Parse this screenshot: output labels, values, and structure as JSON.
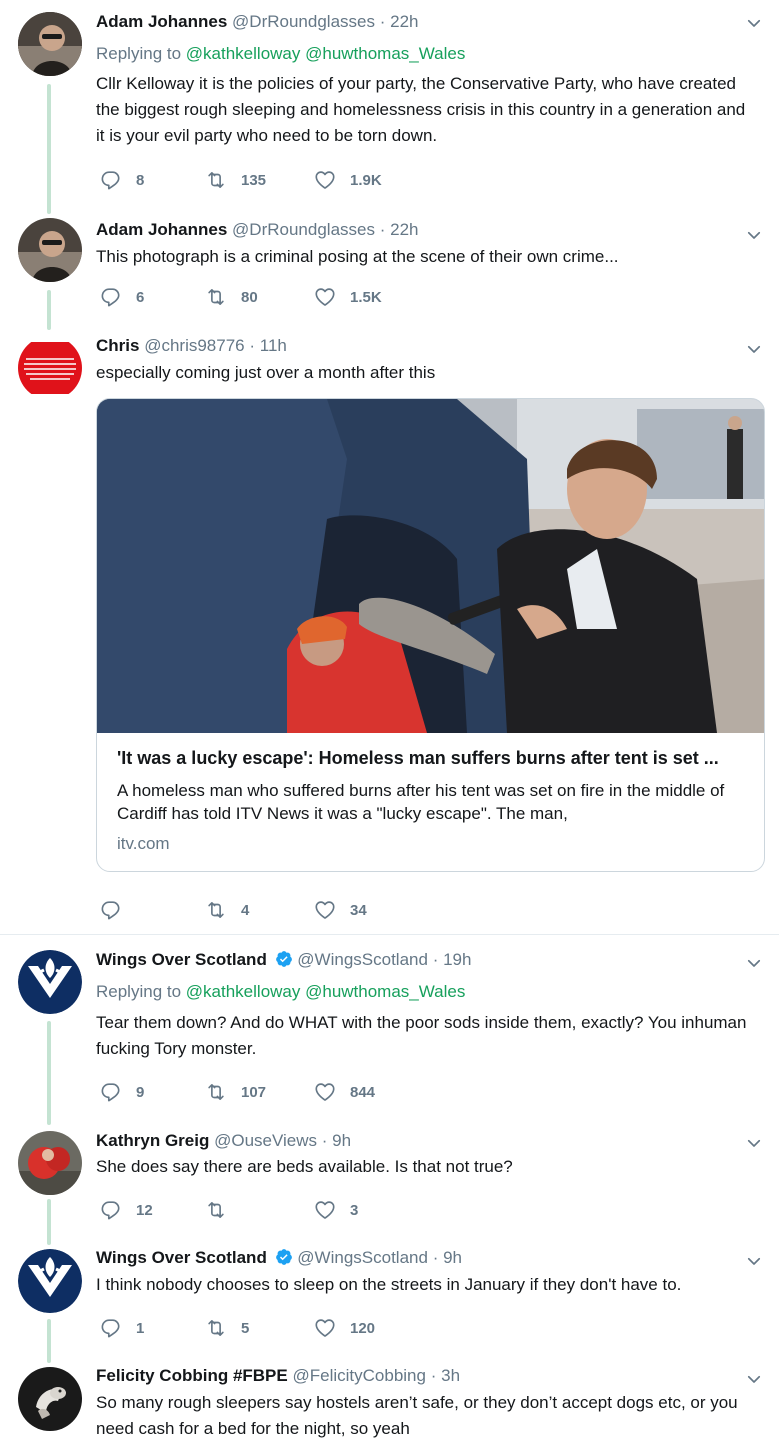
{
  "tweets": [
    {
      "name": "Adam Johannes",
      "handle": "@DrRoundglasses",
      "time": "22h",
      "reply_prefix": "Replying to",
      "reply_mentions": "@kathkelloway @huwthomas_Wales",
      "text": "Cllr Kelloway it is the policies of your party, the Conservative Party, who have created the biggest rough sleeping and homelessness crisis in this country  in a generation and it is your evil party who need to be torn down.",
      "replies": "8",
      "retweets": "135",
      "likes": "1.9K"
    },
    {
      "name": "Adam Johannes",
      "handle": "@DrRoundglasses",
      "time": "22h",
      "text": "This photograph is a criminal posing at the scene of their own crime...",
      "replies": "6",
      "retweets": "80",
      "likes": "1.5K"
    },
    {
      "name": "Chris",
      "handle": "@chris98776",
      "time": "11h",
      "text": "especially coming just over a month after this",
      "card": {
        "title": "'It was a lucky escape': Homeless man suffers burns after tent is set ...",
        "description": "A homeless man who suffered burns after his tent was set on fire in the middle of Cardiff has told ITV News it was a \"lucky escape\". The man,",
        "domain": "itv.com"
      },
      "replies": "",
      "retweets": "4",
      "likes": "34"
    },
    {
      "name": "Wings Over Scotland",
      "handle": "@WingsScotland",
      "time": "19h",
      "reply_prefix": "Replying to",
      "reply_mentions": "@kathkelloway @huwthomas_Wales",
      "text": "Tear them down? And do WHAT with the poor sods inside them, exactly? You inhuman fucking Tory monster.",
      "replies": "9",
      "retweets": "107",
      "likes": "844"
    },
    {
      "name": "Kathryn Greig",
      "handle": "@OuseViews",
      "time": "9h",
      "text": "She does say there are beds available.  Is that not true?",
      "replies": "12",
      "retweets": "",
      "likes": "3"
    },
    {
      "name": "Wings Over Scotland",
      "handle": "@WingsScotland",
      "time": "9h",
      "text": "I think nobody chooses to sleep on the streets in January if they don't have to.",
      "replies": "1",
      "retweets": "5",
      "likes": "120"
    },
    {
      "name": "Felicity Cobbing #FBPE",
      "handle": "@FelicityCobbing",
      "time": "3h",
      "text": "So many rough sleepers say hostels aren’t safe, or they don’t accept dogs etc, or you need cash for a bed for the night, so yeah"
    }
  ],
  "dot": "·",
  "colors": {
    "thread_line": "#c4e3d2",
    "link": "#17a05c",
    "verified": "#1da1f2"
  }
}
